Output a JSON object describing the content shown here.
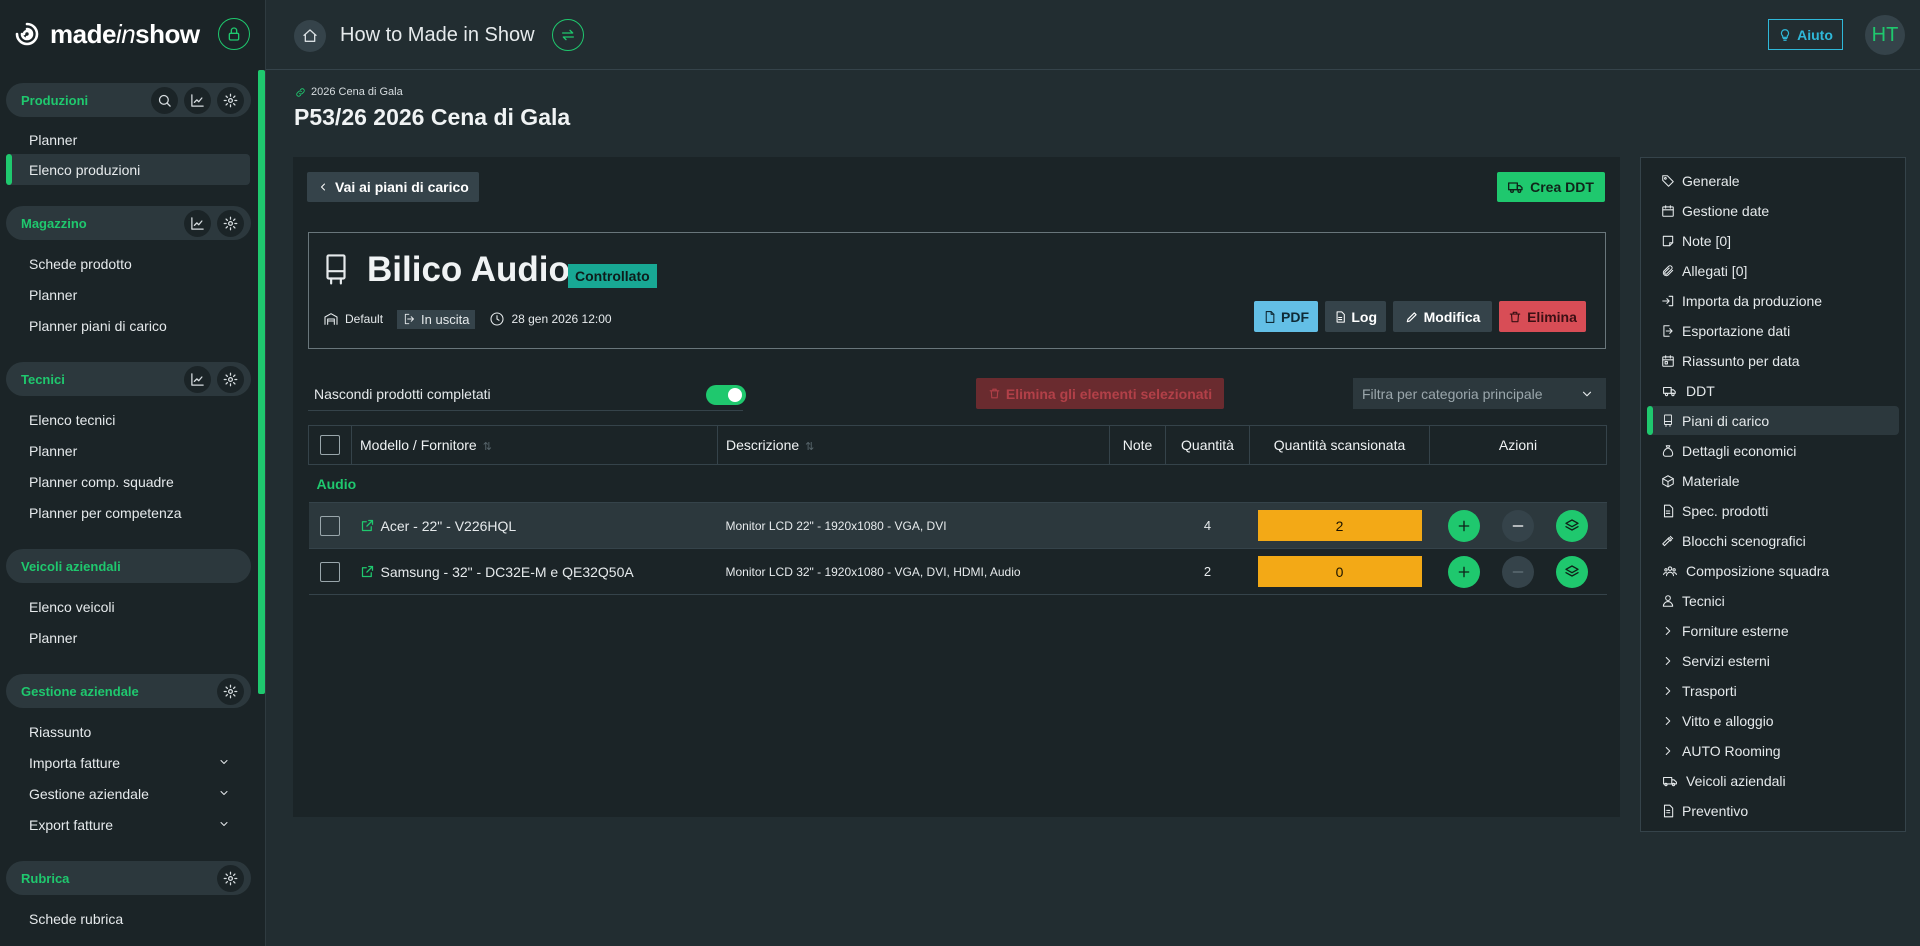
{
  "app": {
    "brand_prefix": "made",
    "brand_italic": "in",
    "brand_suffix": "show"
  },
  "sidebar": {
    "sections": [
      {
        "label": "Produzioni",
        "items": [
          "Planner",
          "Elenco produzioni"
        ]
      },
      {
        "label": "Magazzino",
        "items": [
          "Schede prodotto",
          "Planner",
          "Planner piani di carico"
        ]
      },
      {
        "label": "Tecnici",
        "items": [
          "Elenco tecnici",
          "Planner",
          "Planner comp. squadre",
          "Planner per competenza"
        ]
      },
      {
        "label": "Veicoli aziendali",
        "items": [
          "Elenco veicoli",
          "Planner"
        ]
      },
      {
        "label": "Gestione aziendale",
        "items": [
          "Riassunto",
          "Importa fatture",
          "Gestione aziendale",
          "Export fatture"
        ]
      },
      {
        "label": "Rubrica",
        "items": [
          "Schede rubrica"
        ]
      }
    ]
  },
  "header": {
    "title": "How to Made in Show",
    "help_label": "Aiuto",
    "avatar_initials": "HT"
  },
  "page": {
    "breadcrumb": "2026 Cena di Gala",
    "title": "P53/26 2026 Cena di Gala"
  },
  "main": {
    "back_label": "Vai ai piani di carico",
    "create_ddt_label": "Crea DDT",
    "card": {
      "title": "Bilico Audio",
      "badge": "Controllato",
      "vehicle_type": "Default",
      "direction": "In uscita",
      "datetime": "28 gen 2026 12:00",
      "pdf_label": "PDF",
      "log_label": "Log",
      "edit_label": "Modifica",
      "delete_label": "Elimina"
    },
    "hide_completed_label": "Nascondi prodotti completati",
    "hide_completed_on": true,
    "delete_selected_label": "Elimina gli elementi selezionati",
    "filter_placeholder": "Filtra per categoria principale",
    "table": {
      "headers": {
        "model": "Modello / Fornitore",
        "description": "Descrizione",
        "notes": "Note",
        "quantity": "Quantità",
        "scanned": "Quantità scansionata",
        "actions": "Azioni"
      },
      "group": "Audio",
      "rows": [
        {
          "model": "Acer - 22\" - V226HQL",
          "description": "Monitor LCD 22\" - 1920x1080 - VGA, DVI",
          "quantity": "4",
          "scanned": "2"
        },
        {
          "model": "Samsung - 32\" - DC32E-M e QE32Q50A",
          "description": "Monitor LCD 32\" - 1920x1080 - VGA, DVI, HDMI, Audio",
          "quantity": "2",
          "scanned": "0"
        }
      ]
    }
  },
  "right_menu": {
    "items": [
      "Generale",
      "Gestione date",
      "Note [0]",
      "Allegati [0]",
      "Importa da produzione",
      "Esportazione dati",
      "Riassunto per data",
      "DDT",
      "Piani di carico",
      "Dettagli economici",
      "Materiale",
      "Spec. prodotti",
      "Blocchi scenografici",
      "Composizione squadra",
      "Tecnici",
      "Forniture esterne",
      "Servizi esterni",
      "Trasporti",
      "Vitto e alloggio",
      "AUTO Rooming",
      "Veicoli aziendali",
      "Preventivo"
    ]
  },
  "colors": {
    "accent": "#1fc86e",
    "background": "#222d31",
    "panel": "#1b2427",
    "warning": "#f3a916",
    "danger": "#d84d56",
    "info": "#63bfe6"
  }
}
